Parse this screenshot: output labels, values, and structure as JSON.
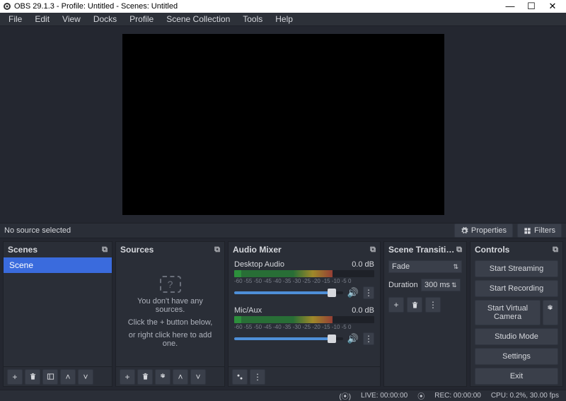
{
  "title": "OBS 29.1.3 - Profile: Untitled - Scenes: Untitled",
  "menu": [
    "File",
    "Edit",
    "View",
    "Docks",
    "Profile",
    "Scene Collection",
    "Tools",
    "Help"
  ],
  "info_row": {
    "no_source": "No source selected",
    "properties": "Properties",
    "filters": "Filters"
  },
  "scenes": {
    "title": "Scenes",
    "items": [
      "Scene"
    ]
  },
  "sources": {
    "title": "Sources",
    "empty1": "You don't have any sources.",
    "empty2": "Click the + button below,",
    "empty3": "or right click here to add one."
  },
  "mixer": {
    "title": "Audio Mixer",
    "channels": [
      {
        "name": "Desktop Audio",
        "db": "0.0 dB"
      },
      {
        "name": "Mic/Aux",
        "db": "0.0 dB"
      }
    ],
    "ticks": "-60 -55 -50 -45 -40 -35 -30 -25 -20 -15 -10 -5 0"
  },
  "transitions": {
    "title": "Scene Transiti…",
    "selected": "Fade",
    "duration_label": "Duration",
    "duration_value": "300 ms"
  },
  "controls": {
    "title": "Controls",
    "buttons": [
      "Start Streaming",
      "Start Recording",
      "Start Virtual Camera",
      "Studio Mode",
      "Settings",
      "Exit"
    ]
  },
  "status": {
    "live": "LIVE: 00:00:00",
    "rec": "REC: 00:00:00",
    "cpu": "CPU: 0.2%, 30.00 fps"
  }
}
